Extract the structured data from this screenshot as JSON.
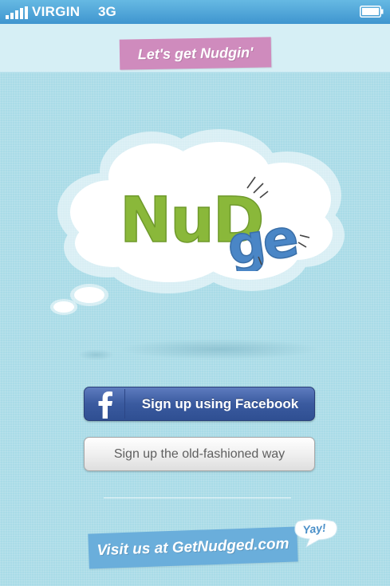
{
  "status_bar": {
    "carrier": "VIRGIN",
    "network": "3G",
    "signal_icon": "signal-bars-icon",
    "battery_icon": "battery-icon"
  },
  "header": {
    "tagline": "Let's get Nudgin'"
  },
  "logo": {
    "text_part_1": "NuD",
    "text_part_2": "ge",
    "colors": {
      "green": "#8ab83a",
      "blue": "#4a86c6"
    }
  },
  "actions": {
    "facebook_signup": "Sign up using Facebook",
    "facebook_icon": "facebook-f-icon",
    "plain_signup": "Sign up the old-fashioned way"
  },
  "footer": {
    "visit_text": "Visit us at GetNudged.com",
    "yay": "Yay!"
  },
  "colors": {
    "background": "#a9dbe7",
    "status_bar": "#4ea6d8",
    "tagline_banner": "#cf8bbd",
    "facebook_blue": "#3b5998",
    "visit_banner": "#6aaedb"
  }
}
